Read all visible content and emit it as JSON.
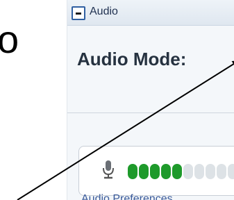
{
  "background": {
    "partial_letter": "o"
  },
  "panel": {
    "header_title": "Audio",
    "section_title": "Audio Mode:",
    "link_text": "Audio Preferences"
  },
  "mic_meter": {
    "level": 0.5,
    "total_bars": 10,
    "active_color": "#1e9a2b",
    "inactive_color": "#dde2e6"
  }
}
